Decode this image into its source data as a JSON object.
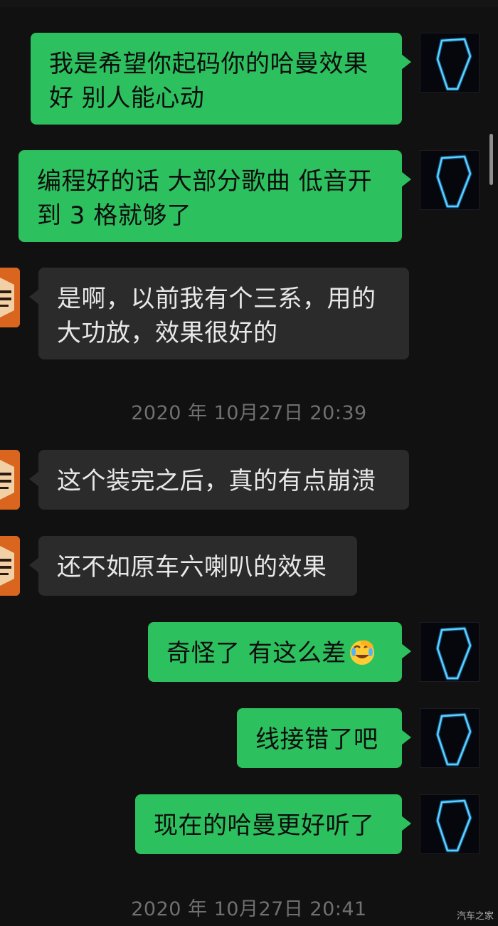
{
  "messages": [
    {
      "dir": "out",
      "lines": [
        "我是希望你起码你的哈曼效果",
        "好 别人能心动"
      ]
    },
    {
      "dir": "out",
      "lines": [
        "编程好的话 大部分歌曲 低音开",
        "到 3 格就够了"
      ]
    },
    {
      "dir": "in",
      "lines": [
        "是啊，以前我有个三系，用的",
        "大功放，效果很好的"
      ]
    },
    {
      "dir": "in",
      "lines": [
        "这个装完之后，真的有点崩溃"
      ]
    },
    {
      "dir": "in",
      "lines": [
        "还不如原车六喇叭的效果"
      ]
    },
    {
      "dir": "out",
      "lines": [
        "奇怪了 有这么差"
      ],
      "emoji": "face-palm-crying-emoji"
    },
    {
      "dir": "out",
      "lines": [
        "线接错了吧"
      ]
    },
    {
      "dir": "out",
      "lines": [
        "现在的哈曼更好听了"
      ]
    }
  ],
  "timestamps": [
    "2020 年 10月27日 20:39",
    "2020 年 10月27日 20:41"
  ],
  "avatars": {
    "me": "neon-coffin-icon",
    "other": "orange-badge-logo"
  },
  "colors": {
    "background": "#111111",
    "outgoing_bubble": "#2dc05e",
    "incoming_bubble": "#2b2b2b",
    "timestamp_text": "#707070",
    "neon": "#1aa8ff",
    "other_avatar": "#d9651f"
  },
  "watermark": "汽车之家"
}
